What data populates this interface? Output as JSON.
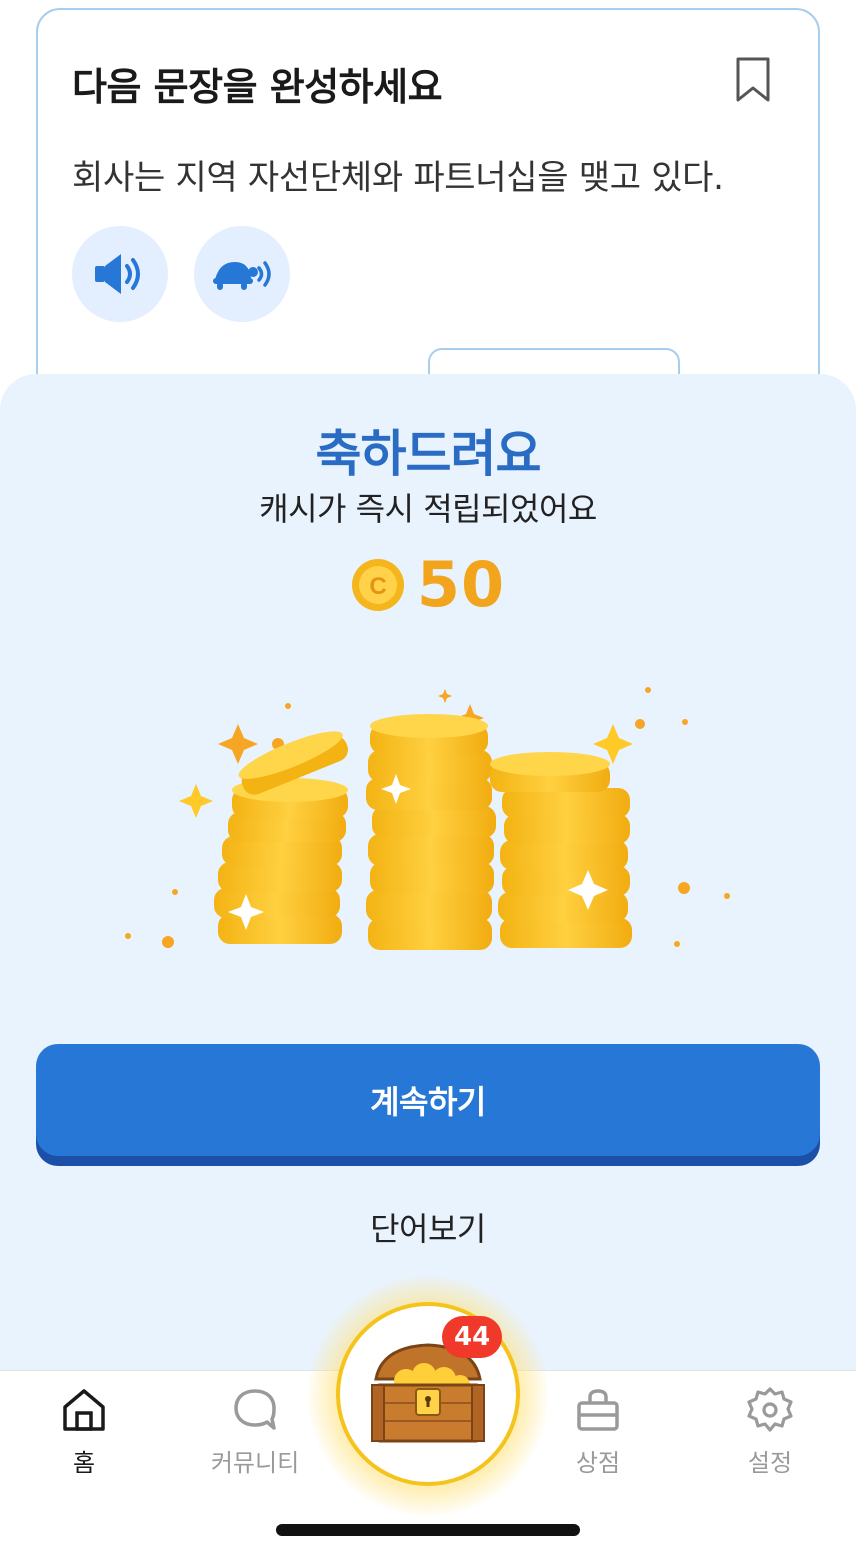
{
  "question": {
    "title": "다음 문장을 완성하세요",
    "sentence": "회사는 지역 자선단체와 파트너십을 맺고 있다.",
    "icons": {
      "bookmark": "bookmark-icon",
      "normal_audio": "speaker-icon",
      "slow_audio": "turtle-speaker-icon"
    }
  },
  "reward": {
    "title": "축하드려요",
    "subtitle": "캐시가 즉시 적립되었어요",
    "amount": "50",
    "coin_letter": "C"
  },
  "actions": {
    "continue_label": "계속하기",
    "words_label": "단어보기"
  },
  "tabbar": {
    "home": "홈",
    "community": "커뮤니티",
    "chest_badge": "44",
    "shop": "상점",
    "settings": "설정"
  },
  "colors": {
    "accent": "#2777d6",
    "title_blue": "#2a6cc4",
    "coin": "#f2a41c",
    "sheet": "#e9f3fe",
    "badge": "#f0382b"
  }
}
